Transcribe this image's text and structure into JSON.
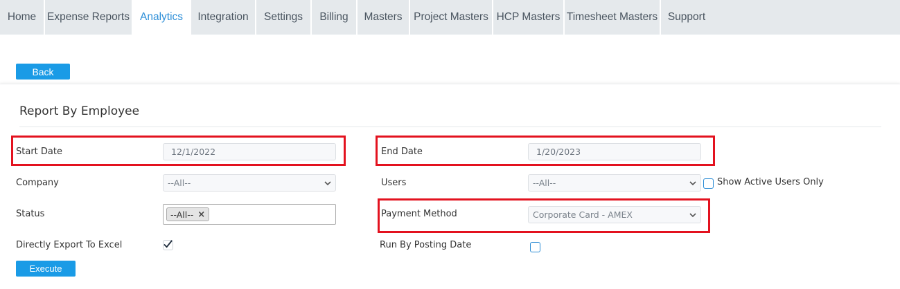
{
  "tabs": [
    {
      "label": "Home",
      "active": false
    },
    {
      "label": "Expense Reports",
      "active": false
    },
    {
      "label": "Analytics",
      "active": true
    },
    {
      "label": "Integration",
      "active": false
    },
    {
      "label": "Settings",
      "active": false
    },
    {
      "label": "Billing",
      "active": false
    },
    {
      "label": "Masters",
      "active": false
    },
    {
      "label": "Project Masters",
      "active": false
    },
    {
      "label": "HCP Masters",
      "active": false
    },
    {
      "label": "Timesheet Masters",
      "active": false
    },
    {
      "label": "Support",
      "active": false
    }
  ],
  "back_button": "Back",
  "report": {
    "title": "Report By Employee",
    "start_date": {
      "label": "Start Date",
      "value": "12/1/2022"
    },
    "end_date": {
      "label": "End Date",
      "value": "1/20/2023"
    },
    "company": {
      "label": "Company",
      "value": "--All--"
    },
    "users": {
      "label": "Users",
      "value": "--All--"
    },
    "show_active_users": {
      "label": "Show Active Users Only",
      "checked": false
    },
    "status": {
      "label": "Status",
      "chip": "--All--",
      "chip_remove": "×"
    },
    "payment_method": {
      "label": "Payment Method",
      "value": "Corporate Card - AMEX"
    },
    "export_excel": {
      "label": "Directly Export To Excel",
      "checked": true
    },
    "posting_date": {
      "label": "Run By Posting Date",
      "checked": false
    },
    "execute_button": "Execute"
  },
  "colors": {
    "accent": "#1a9be6",
    "active_tab_text": "#2e8fd8",
    "highlight_red": "#e3121f",
    "tab_bg": "#e5e9ec"
  },
  "icons": {
    "dropdown": "chevron-down-icon",
    "check": "check-icon",
    "remove": "close-icon"
  }
}
